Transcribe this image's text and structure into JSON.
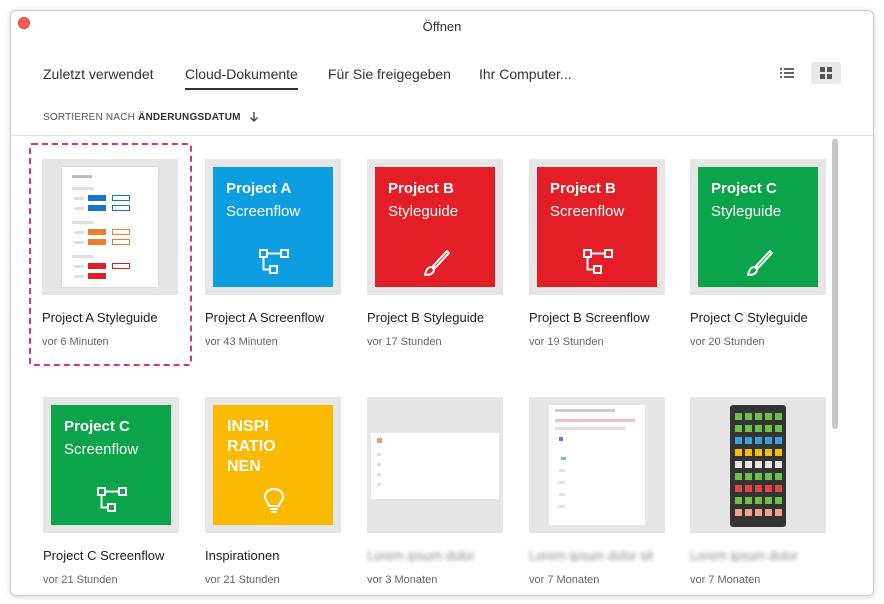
{
  "window": {
    "title": "Öffnen"
  },
  "tabs": [
    {
      "label": "Zuletzt verwendet"
    },
    {
      "label": "Cloud-Dokumente"
    },
    {
      "label": "Für Sie freigegeben"
    },
    {
      "label": "Ihr Computer..."
    }
  ],
  "active_tab": "Cloud-Dokumente",
  "view_modes": {
    "list_icon": "list-icon",
    "grid_icon": "grid-icon",
    "active": "grid"
  },
  "sort": {
    "prefix": "SORTIEREN NACH",
    "field": "ÄNDERUNGSDATUM",
    "direction_icon": "arrow-down-icon"
  },
  "colors": {
    "blue": "#0d9ee2",
    "red": "#e41e26",
    "green": "#0ba44a",
    "yellow": "#fbb900",
    "selection": "#d63384"
  },
  "files": [
    {
      "name": "Project A Styleguide",
      "time": "vor 6 Minuten",
      "tile": "preview-styleguide",
      "selected": true
    },
    {
      "name": "Project A Screenflow",
      "time": "vor 43 Minuten",
      "tile_line1": "Project A",
      "tile_line2": "Screenflow",
      "color": "#0d9ee2",
      "icon": "flow-icon"
    },
    {
      "name": "Project B Styleguide",
      "time": "vor 17 Stunden",
      "tile_line1": "Project B",
      "tile_line2": "Styleguide",
      "color": "#e41e26",
      "icon": "brush-icon"
    },
    {
      "name": "Project B Screenflow",
      "time": "vor 19 Stunden",
      "tile_line1": "Project B",
      "tile_line2": "Screenflow",
      "color": "#e41e26",
      "icon": "flow-icon"
    },
    {
      "name": "Project C Styleguide",
      "time": "vor 20 Stunden",
      "tile_line1": "Project C",
      "tile_line2": "Styleguide",
      "color": "#0ba44a",
      "icon": "brush-icon"
    },
    {
      "name": "Project C Screenflow",
      "time": "vor 21 Stunden",
      "tile_line1": "Project C",
      "tile_line2": "Screenflow",
      "color": "#0ba44a",
      "icon": "flow-icon"
    },
    {
      "name": "Inspirationen",
      "time": "vor 21 Stunden",
      "tile_lines": [
        "INSPI",
        "RATIO",
        "NEN"
      ],
      "color": "#fbb900",
      "icon": "lightbulb-icon"
    },
    {
      "name": "",
      "time": "vor 3 Monaten",
      "tile": "preview-blank"
    },
    {
      "name": "",
      "time": "vor 7 Monaten",
      "tile": "preview-document"
    },
    {
      "name": "",
      "time": "vor 7 Monaten",
      "tile": "preview-phone-grid"
    }
  ]
}
